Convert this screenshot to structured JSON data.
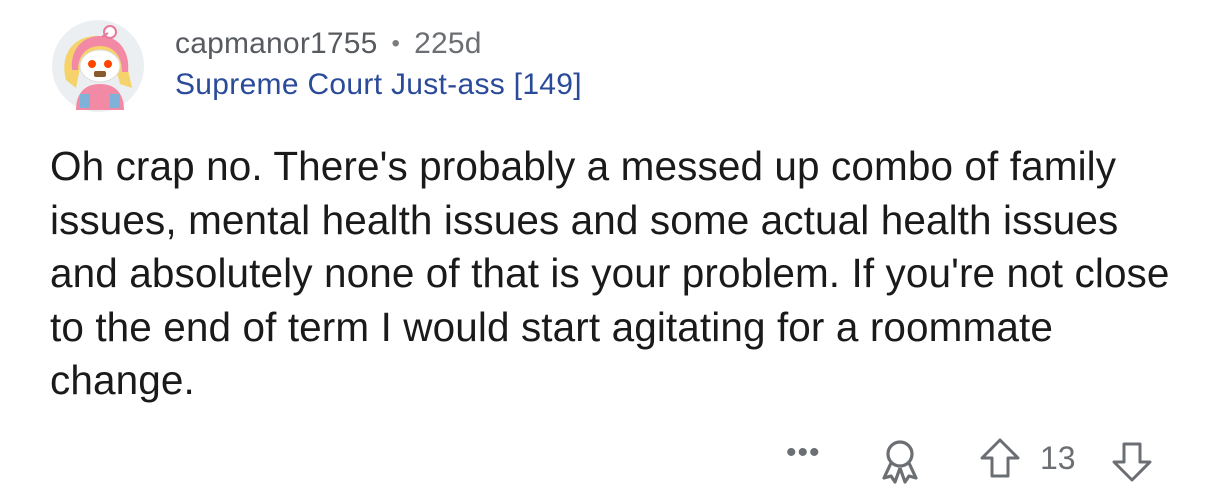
{
  "comment": {
    "username": "capmanor1755",
    "separator": "•",
    "age": "225d",
    "flair": "Supreme Court Just-ass [149]",
    "body": "Oh crap no. There's probably a messed up combo of family issues, mental health issues and some actual health issues and absolutely none of that is your problem. If you're not close to the end of term I would start agitating for a roommate change.",
    "actions": {
      "more_label": "•••",
      "score": "13"
    }
  },
  "icons": {
    "avatar": "snoo-avatar-icon",
    "more": "more-options-icon",
    "award": "award-icon",
    "upvote": "upvote-arrow-icon",
    "downvote": "downvote-arrow-icon"
  },
  "colors": {
    "username": "#575b5f",
    "flair": "#2a4a9a",
    "body_text": "#1a1a1b",
    "icon_gray": "#6b6f73"
  }
}
